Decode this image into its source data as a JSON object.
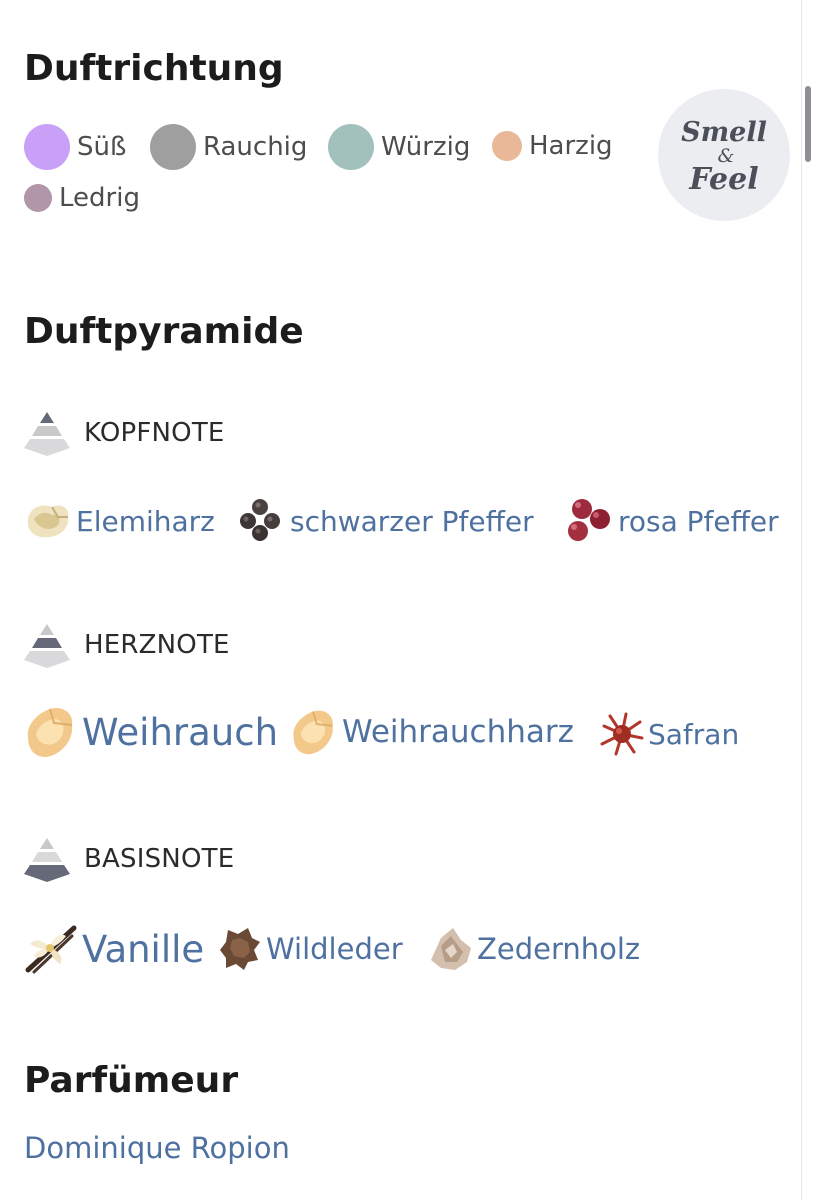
{
  "duftrichtung": {
    "title": "Duftrichtung",
    "accords": [
      {
        "label": "Süß",
        "color": "#c9a0f7"
      },
      {
        "label": "Rauchig",
        "color": "#9f9f9f"
      },
      {
        "label": "Würzig",
        "color": "#a2c0bc"
      },
      {
        "label": "Harzig",
        "color": "#e8b898"
      },
      {
        "label": "Ledrig",
        "color": "#b195a8"
      }
    ],
    "logo": {
      "line1": "Smell",
      "amp": "&",
      "line2": "Feel",
      "icon": "smell-and-feel-logo"
    }
  },
  "duftpyramide": {
    "title": "Duftpyramide",
    "tiers": [
      {
        "label": "KOPFNOTE",
        "icon": "pyramid-top-icon",
        "notes": [
          {
            "label": "Elemiharz",
            "icon": "elemi-resin-icon"
          },
          {
            "label": "schwarzer Pfeffer",
            "icon": "black-pepper-icon"
          },
          {
            "label": "rosa Pfeffer",
            "icon": "pink-pepper-icon"
          }
        ]
      },
      {
        "label": "HERZNOTE",
        "icon": "pyramid-middle-icon",
        "notes": [
          {
            "label": "Weihrauch",
            "icon": "frankincense-icon"
          },
          {
            "label": "Weihrauchharz",
            "icon": "frankincense-resin-icon"
          },
          {
            "label": "Safran",
            "icon": "saffron-icon"
          }
        ]
      },
      {
        "label": "BASISNOTE",
        "icon": "pyramid-base-icon",
        "notes": [
          {
            "label": "Vanille",
            "icon": "vanilla-icon"
          },
          {
            "label": "Wildleder",
            "icon": "suede-icon"
          },
          {
            "label": "Zedernholz",
            "icon": "cedarwood-icon"
          }
        ]
      }
    ]
  },
  "parfuemeur": {
    "title": "Parfümeur",
    "name": "Dominique Ropion"
  },
  "colors": {
    "link": "#4f71a0",
    "text": "#1c1c1e",
    "muted": "#4d4d50"
  }
}
